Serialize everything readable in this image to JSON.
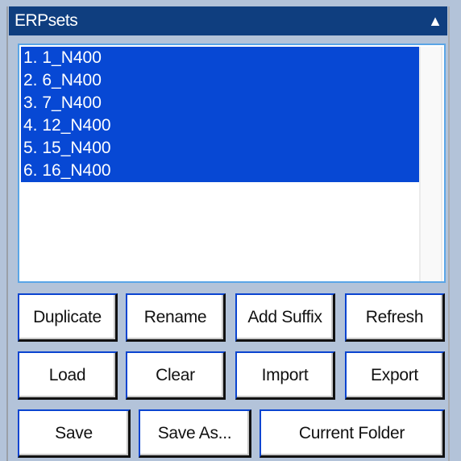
{
  "panel": {
    "title": "ERPsets",
    "collapse_icon": "▲"
  },
  "erpsets": {
    "items": [
      {
        "label": "1. 1_N400",
        "selected": true
      },
      {
        "label": "2. 6_N400",
        "selected": true
      },
      {
        "label": "3. 7_N400",
        "selected": true
      },
      {
        "label": "4. 12_N400",
        "selected": true
      },
      {
        "label": "5. 15_N400",
        "selected": true
      },
      {
        "label": "6. 16_N400",
        "selected": true
      }
    ]
  },
  "buttons": {
    "duplicate": "Duplicate",
    "rename": "Rename",
    "add_suffix": "Add Suffix",
    "refresh": "Refresh",
    "load": "Load",
    "clear": "Clear",
    "import": "Import",
    "export": "Export",
    "save": "Save",
    "save_as": "Save As...",
    "current_folder": "Current Folder"
  },
  "colors": {
    "header": "#0f3e7f",
    "selection": "#0748d4",
    "background": "#b3c3d9"
  }
}
